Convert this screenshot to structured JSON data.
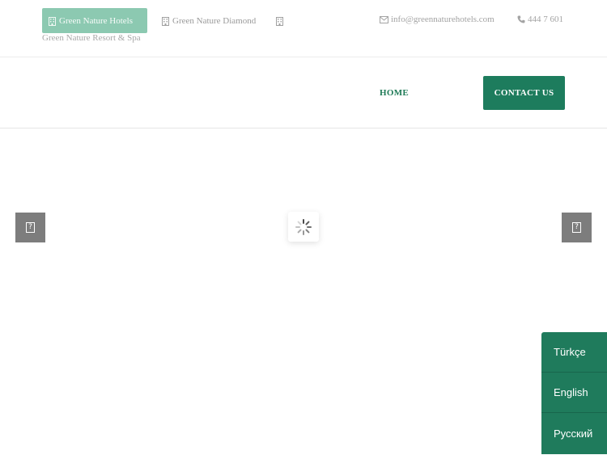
{
  "topbar": {
    "hotels": [
      {
        "label": "Green Nature Hotels",
        "active": true
      },
      {
        "label": "Green Nature Diamond",
        "active": false
      },
      {
        "label": "Green Nature Resort & Spa",
        "active": false
      }
    ],
    "email": "info@greennaturehotels.com",
    "phone": "444 7 601"
  },
  "nav": {
    "home_label": "HOME",
    "contact_label": "CONTACT US"
  },
  "slider": {
    "prev_glyph": "?",
    "next_glyph": "?"
  },
  "languages": [
    {
      "label": "Türkçe"
    },
    {
      "label": "English"
    },
    {
      "label": "Русский"
    }
  ],
  "colors": {
    "brand_green": "#1d7c5d",
    "active_tab": "#8cc9b1",
    "arrow_bg": "#7d7d7d"
  },
  "icons": {
    "hotel": "building-icon",
    "email": "envelope-icon",
    "phone": "phone-icon",
    "loader": "spinner-icon"
  }
}
